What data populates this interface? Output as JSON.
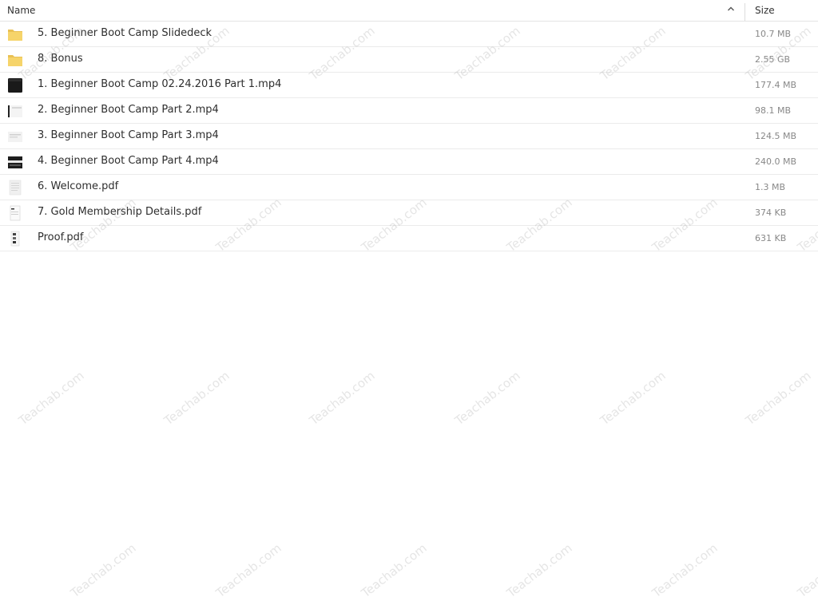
{
  "header": {
    "name_label": "Name",
    "size_label": "Size",
    "sort_direction": "ascending"
  },
  "files": [
    {
      "name": "5. Beginner Boot Camp Slidedeck",
      "size": "10.7 MB",
      "icon": "folder-icon"
    },
    {
      "name": "8. Bonus",
      "size": "2.55 GB",
      "icon": "folder-icon"
    },
    {
      "name": "1. Beginner Boot Camp 02.24.2016 Part 1.mp4",
      "size": "177.4 MB",
      "icon": "video-thumbnail-icon"
    },
    {
      "name": "2. Beginner Boot Camp Part 2.mp4",
      "size": "98.1 MB",
      "icon": "video-thumbnail-icon"
    },
    {
      "name": "3. Beginner Boot Camp Part 3.mp4",
      "size": "124.5 MB",
      "icon": "video-thumbnail-icon"
    },
    {
      "name": "4. Beginner Boot Camp Part 4.mp4",
      "size": "240.0 MB",
      "icon": "video-thumbnail-icon"
    },
    {
      "name": "6. Welcome.pdf",
      "size": "1.3 MB",
      "icon": "pdf-thumbnail-icon"
    },
    {
      "name": "7. Gold Membership Details.pdf",
      "size": "374 KB",
      "icon": "pdf-thumbnail-icon"
    },
    {
      "name": "Proof.pdf",
      "size": "631 KB",
      "icon": "pdf-thumbnail-icon"
    }
  ],
  "watermark": {
    "text": "Teachab.com"
  },
  "colors": {
    "folder": "#f6d46a",
    "folder_tab": "#e9c154",
    "divider": "#ebebeb"
  }
}
